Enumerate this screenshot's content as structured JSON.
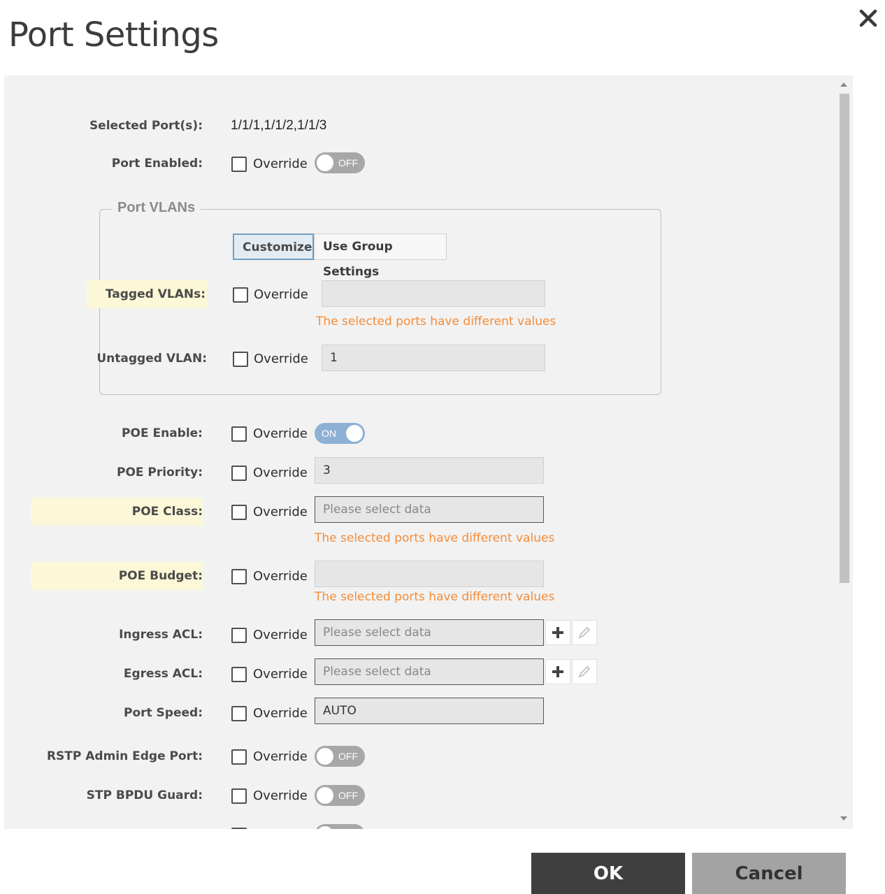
{
  "dialog": {
    "title": "Port Settings",
    "close_icon": "close-icon"
  },
  "rows": {
    "selected_ports": {
      "label": "Selected Port(s):",
      "value": "1/1/1,1/1/2,1/1/3"
    },
    "port_enabled": {
      "label": "Port Enabled:",
      "override": "Override",
      "toggle": "OFF"
    },
    "poe_enable": {
      "label": "POE Enable:",
      "override": "Override",
      "toggle": "ON"
    },
    "poe_priority": {
      "label": "POE Priority:",
      "override": "Override",
      "value": "3"
    },
    "poe_class": {
      "label": "POE Class:",
      "override": "Override",
      "placeholder": "Please select data",
      "warning": "The selected ports have different values"
    },
    "poe_budget": {
      "label": "POE Budget:",
      "override": "Override",
      "value": "",
      "warning": "The selected ports have different values"
    },
    "ingress_acl": {
      "label": "Ingress ACL:",
      "override": "Override",
      "placeholder": "Please select data"
    },
    "egress_acl": {
      "label": "Egress ACL:",
      "override": "Override",
      "placeholder": "Please select data"
    },
    "port_speed": {
      "label": "Port Speed:",
      "override": "Override",
      "value": "AUTO"
    },
    "rstp_admin_edge": {
      "label": "RSTP Admin Edge Port:",
      "override": "Override",
      "toggle": "OFF"
    },
    "stp_bpdu_guard": {
      "label": "STP BPDU Guard:",
      "override": "Override",
      "toggle": "OFF"
    }
  },
  "port_vlans": {
    "legend": "Port VLANs",
    "tabs": [
      "Customize",
      "Use Group Settings"
    ],
    "tagged": {
      "label": "Tagged VLANs:",
      "override": "Override",
      "value": "",
      "warning": "The selected ports have different values"
    },
    "untagged": {
      "label": "Untagged VLAN:",
      "override": "Override",
      "value": "1"
    }
  },
  "footer": {
    "ok": "OK",
    "cancel": "Cancel"
  },
  "colors": {
    "warning": "#f58c38",
    "toggle_on": "#8db0d4",
    "toggle_off": "#a7a7a7",
    "highlight": "#fcf8d7",
    "ok_button": "#3f3f3f",
    "cancel_button": "#a3a3a3"
  }
}
